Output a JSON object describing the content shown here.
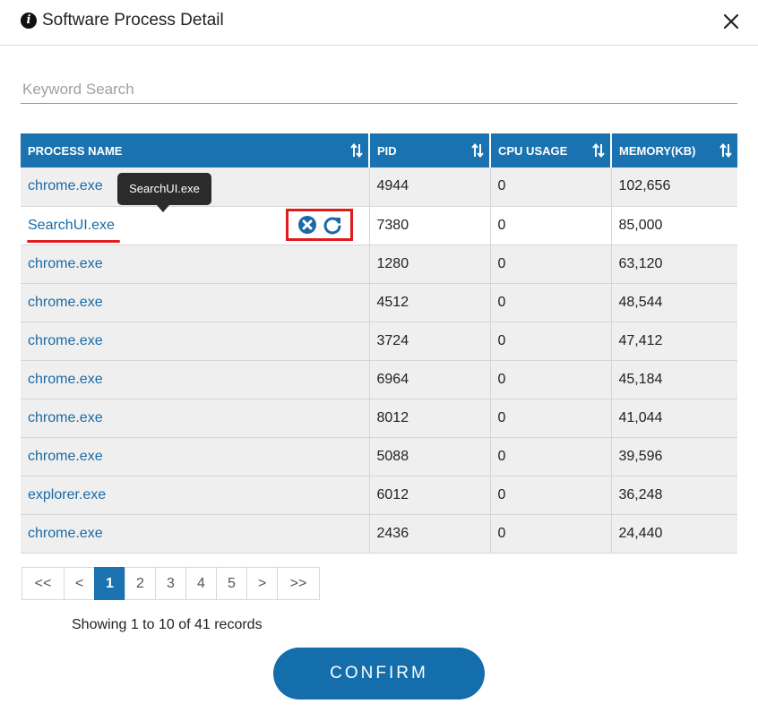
{
  "dialog": {
    "title": "Software Process Detail"
  },
  "search": {
    "placeholder": "Keyword Search",
    "value": ""
  },
  "table": {
    "columns": [
      "PROCESS NAME",
      "PID",
      "CPU USAGE",
      "MEMORY(KB)"
    ],
    "rows": [
      {
        "name": "chrome.exe",
        "pid": "4944",
        "cpu": "0",
        "memory": "102,656"
      },
      {
        "name": "SearchUI.exe",
        "pid": "7380",
        "cpu": "0",
        "memory": "85,000"
      },
      {
        "name": "chrome.exe",
        "pid": "1280",
        "cpu": "0",
        "memory": "63,120"
      },
      {
        "name": "chrome.exe",
        "pid": "4512",
        "cpu": "0",
        "memory": "48,544"
      },
      {
        "name": "chrome.exe",
        "pid": "3724",
        "cpu": "0",
        "memory": "47,412"
      },
      {
        "name": "chrome.exe",
        "pid": "6964",
        "cpu": "0",
        "memory": "45,184"
      },
      {
        "name": "chrome.exe",
        "pid": "8012",
        "cpu": "0",
        "memory": "41,044"
      },
      {
        "name": "chrome.exe",
        "pid": "5088",
        "cpu": "0",
        "memory": "39,596"
      },
      {
        "name": "explorer.exe",
        "pid": "6012",
        "cpu": "0",
        "memory": "36,248"
      },
      {
        "name": "chrome.exe",
        "pid": "2436",
        "cpu": "0",
        "memory": "24,440"
      }
    ]
  },
  "tooltip": {
    "text": "SearchUI.exe"
  },
  "row_actions": {
    "icons": [
      "close-circle-icon",
      "refresh-icon"
    ],
    "highlight_color": "#e01b1b"
  },
  "pagination": {
    "first": "<<",
    "prev": "<",
    "pages": [
      "1",
      "2",
      "3",
      "4",
      "5"
    ],
    "current": "1",
    "next": ">",
    "last": ">>"
  },
  "records_text": "Showing 1 to 10 of 41 records",
  "confirm_label": "CONFIRM",
  "colors": {
    "accent": "#1a73b0",
    "link": "#1a6aa6"
  }
}
